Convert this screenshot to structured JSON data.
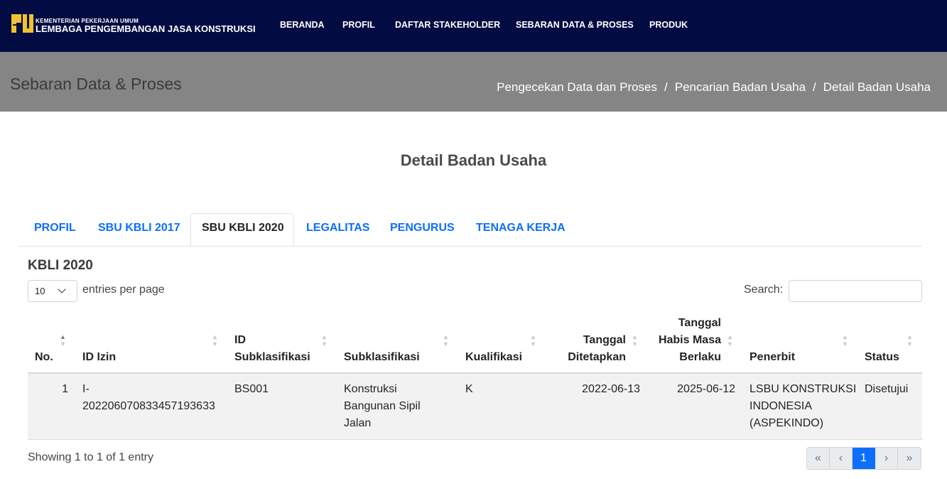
{
  "brand": {
    "small": "KEMENTERIAN PEKERJAAN UMUM",
    "big": "LEMBAGA PENGEMBANGAN JASA KONSTRUKSI"
  },
  "nav": [
    "BERANDA",
    "PROFIL",
    "DAFTAR STAKEHOLDER",
    "SEBARAN DATA & PROSES",
    "PRODUK"
  ],
  "page_header": {
    "title": "Sebaran Data & Proses",
    "breadcrumb": [
      "Pengecekan Data dan Proses",
      "Pencarian Badan Usaha",
      "Detail Badan Usaha"
    ],
    "separator": "/"
  },
  "main_title": "Detail Badan Usaha",
  "tabs": [
    "PROFIL",
    "SBU KBLI 2017",
    "SBU KBLI 2020",
    "LEGALITAS",
    "PENGURUS",
    "TENAGA KERJA"
  ],
  "active_tab": "SBU KBLI 2020",
  "section_title": "KBLI 2020",
  "controls": {
    "per_page_value": "10",
    "per_page_label": "entries per page",
    "search_label": "Search:",
    "search_value": ""
  },
  "table": {
    "headers": {
      "no": "No.",
      "id_izin": "ID Izin",
      "id_sub_1": "ID",
      "id_sub_2": "Subklasifikasi",
      "subklasifikasi": "Subklasifikasi",
      "kualifikasi": "Kualifikasi",
      "tgl_tetap_1": "Tanggal",
      "tgl_tetap_2": "Ditetapkan",
      "tgl_habis_1": "Tanggal",
      "tgl_habis_2": "Habis Masa",
      "tgl_habis_3": "Berlaku",
      "penerbit": "Penerbit",
      "status": "Status"
    },
    "rows": [
      {
        "no": "1",
        "id_izin_1": "I-",
        "id_izin_2": "20220607083345719363​3",
        "id_sub": "BS001",
        "sub_1": "Konstruksi",
        "sub_2": "Bangunan Sipil",
        "sub_3": "Jalan",
        "kualifikasi": "K",
        "tgl_tetap": "2022-06-13",
        "tgl_habis": "2025-06-12",
        "pen_1": "LSBU KONSTRUKSI",
        "pen_2": "INDONESIA",
        "pen_3": "(ASPEKINDO)",
        "status": "Disetujui"
      }
    ]
  },
  "footer": {
    "info": "Showing 1 to 1 of 1 entry",
    "pager": [
      "«",
      "‹",
      "1",
      "›",
      "»"
    ],
    "current_page": "1"
  },
  "colors": {
    "navbar": "#030c42",
    "header_band": "#858585",
    "link": "#0d6efd",
    "row_bg": "#f2f2f2"
  }
}
